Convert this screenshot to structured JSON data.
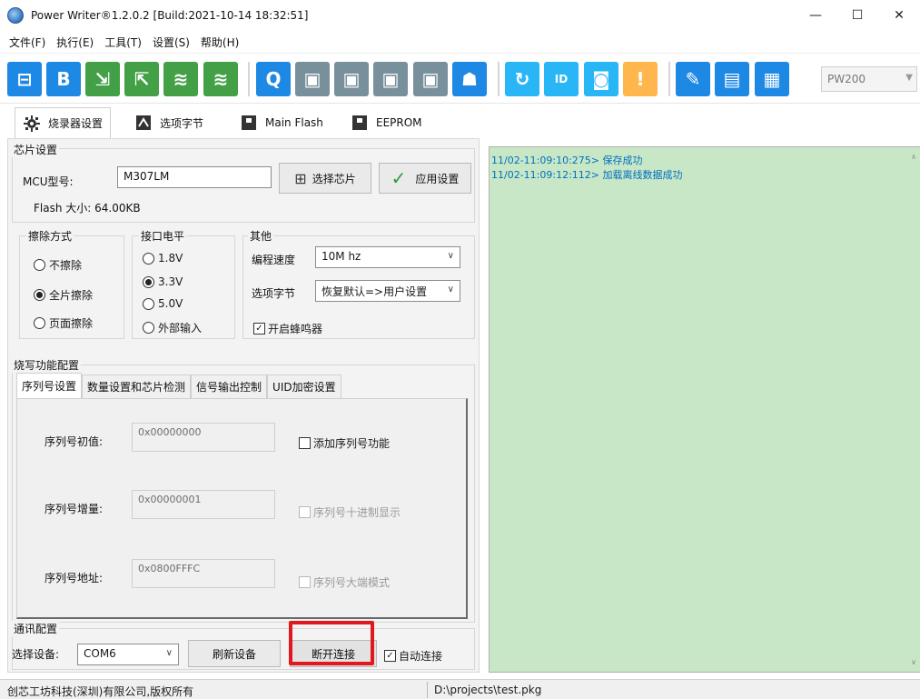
{
  "window": {
    "title": "Power Writer®1.2.0.2 [Build:2021-10-14 18:32:51]",
    "controls": {
      "minimize": "—",
      "maximize": "☐",
      "close": "✕"
    }
  },
  "menu": [
    "文件(F)",
    "执行(E)",
    "工具(T)",
    "设置(S)",
    "帮助(H)"
  ],
  "toolbar": {
    "buttons": [
      {
        "name": "open-project-icon",
        "color": "#1e88e5",
        "glyph": "⊟"
      },
      {
        "name": "save-project-icon",
        "color": "#1e88e5",
        "glyph": "B"
      },
      {
        "name": "import-icon",
        "color": "#43a047",
        "glyph": "⇲"
      },
      {
        "name": "export-icon",
        "color": "#43a047",
        "glyph": "⇱"
      },
      {
        "name": "offline-load-icon",
        "color": "#43a047",
        "glyph": "≋"
      },
      {
        "name": "offline-save-icon",
        "color": "#43a047",
        "glyph": "≋"
      },
      {
        "name": "search-icon",
        "color": "#1e88e5",
        "glyph": "Q"
      },
      {
        "name": "erase-icon",
        "color": "#78909c",
        "glyph": "▣"
      },
      {
        "name": "read-icon",
        "color": "#78909c",
        "glyph": "▣"
      },
      {
        "name": "write-icon",
        "color": "#78909c",
        "glyph": "▣"
      },
      {
        "name": "verify-icon",
        "color": "#78909c",
        "glyph": "▣"
      },
      {
        "name": "robot-icon",
        "color": "#1e88e5",
        "glyph": "☗"
      },
      {
        "name": "reset-icon",
        "color": "#29b6f6",
        "glyph": "↻"
      },
      {
        "name": "id-icon",
        "color": "#29b6f6",
        "glyph": "ID"
      },
      {
        "name": "stop-icon",
        "color": "#29b6f6",
        "glyph": "◙"
      },
      {
        "name": "warning-icon",
        "color": "#ffb74d",
        "glyph": "!"
      },
      {
        "name": "plugin-icon",
        "color": "#1e88e5",
        "glyph": "✎"
      },
      {
        "name": "script-icon",
        "color": "#1e88e5",
        "glyph": "▤"
      },
      {
        "name": "layout-icon",
        "color": "#1e88e5",
        "glyph": "▦"
      }
    ],
    "device_select": "PW200"
  },
  "tabs": [
    {
      "label": "烧录器设置",
      "icon": "gear-icon"
    },
    {
      "label": "选项字节",
      "icon": "option-byte-icon"
    },
    {
      "label": "Main Flash",
      "icon": "flash-icon"
    },
    {
      "label": "EEPROM",
      "icon": "eeprom-icon"
    }
  ],
  "chip": {
    "group": "芯片设置",
    "mcu_label": "MCU型号:",
    "mcu_value": "M307LM",
    "select_chip": "选择芯片",
    "apply": "应用设置",
    "flash_size": "Flash 大小: 64.00KB"
  },
  "erase": {
    "group": "擦除方式",
    "options": [
      "不擦除",
      "全片擦除",
      "页面擦除"
    ],
    "selected": "全片擦除"
  },
  "voltage": {
    "group": "接口电平",
    "options": [
      "1.8V",
      "3.3V",
      "5.0V",
      "外部输入"
    ],
    "selected": "3.3V"
  },
  "other": {
    "group": "其他",
    "speed_label": "编程速度",
    "speed_value": "10M hz",
    "optbyte_label": "选项字节",
    "optbyte_value": "恢复默认=>用户设置",
    "buzzer": "开启蜂鸣器",
    "buzzer_checked": true
  },
  "burn": {
    "group": "烧写功能配置",
    "tabs": [
      "序列号设置",
      "数量设置和芯片检测",
      "信号输出控制",
      "UID加密设置"
    ],
    "fields": [
      {
        "label": "序列号初值:",
        "value": "0x00000000",
        "check": "添加序列号功能",
        "enabled": true
      },
      {
        "label": "序列号增量:",
        "value": "0x00000001",
        "check": "序列号十进制显示",
        "enabled": false
      },
      {
        "label": "序列号地址:",
        "value": "0x0800FFFC",
        "check": "序列号大端模式",
        "enabled": false
      }
    ]
  },
  "comm": {
    "group": "通讯配置",
    "device_label": "选择设备:",
    "port": "COM6",
    "refresh": "刷新设备",
    "disconnect": "断开连接",
    "auto": "自动连接",
    "auto_checked": true
  },
  "log": [
    "11/02-11:09:10:275> 保存成功",
    "11/02-11:09:12:112> 加载离线数据成功"
  ],
  "status": {
    "copyright": "创芯工坊科技(深圳)有限公司,版权所有",
    "path": "D:\\projects\\test.pkg"
  }
}
